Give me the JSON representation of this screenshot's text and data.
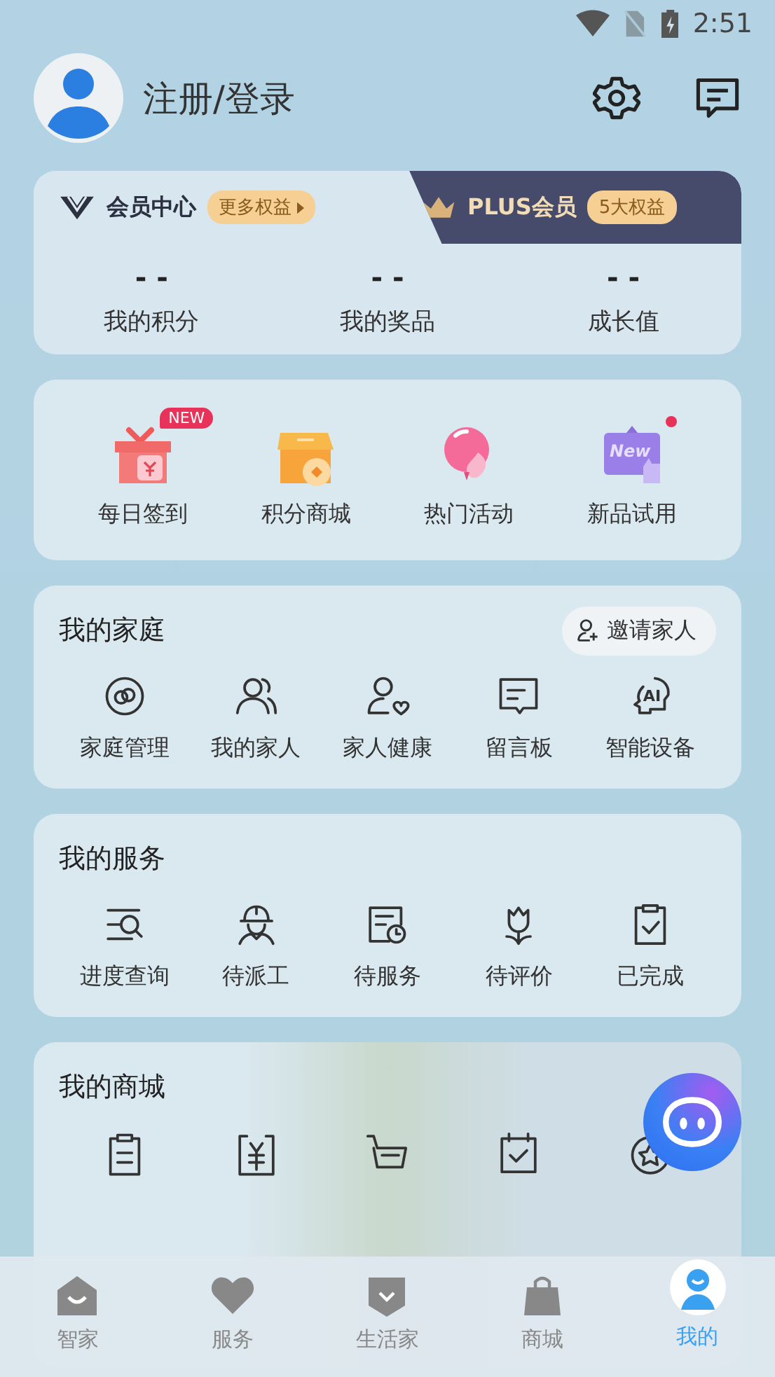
{
  "status_bar": {
    "time": "2:51"
  },
  "header": {
    "title": "注册/登录"
  },
  "member": {
    "tabs": [
      {
        "label": "会员中心",
        "badge": "更多权益",
        "kind": "member",
        "selected": true
      },
      {
        "label": "PLUS会员",
        "badge": "5大权益",
        "kind": "plus",
        "selected": false
      }
    ],
    "stats": [
      {
        "value": "- -",
        "label": "我的积分"
      },
      {
        "value": "- -",
        "label": "我的奖品"
      },
      {
        "value": "- -",
        "label": "成长值"
      }
    ]
  },
  "quick": [
    {
      "label": "每日签到",
      "kind": "gift",
      "badge": "NEW",
      "dot": false
    },
    {
      "label": "积分商城",
      "kind": "shop",
      "dot": false
    },
    {
      "label": "热门活动",
      "kind": "balloon",
      "dot": false
    },
    {
      "label": "新品试用",
      "kind": "new",
      "icon_text": "New",
      "dot": true
    }
  ],
  "family": {
    "title": "我的家庭",
    "action": "邀请家人",
    "items": [
      {
        "label": "家庭管理",
        "kind": "rings"
      },
      {
        "label": "我的家人",
        "kind": "people"
      },
      {
        "label": "家人健康",
        "kind": "health"
      },
      {
        "label": "留言板",
        "kind": "board"
      },
      {
        "label": "智能设备",
        "kind": "ai",
        "icon_text": "AI"
      }
    ]
  },
  "services": {
    "title": "我的服务",
    "items": [
      {
        "label": "进度查询",
        "kind": "search"
      },
      {
        "label": "待派工",
        "kind": "worker"
      },
      {
        "label": "待服务",
        "kind": "clock"
      },
      {
        "label": "待评价",
        "kind": "tulip"
      },
      {
        "label": "已完成",
        "kind": "done"
      }
    ]
  },
  "mall": {
    "title": "我的商城",
    "items": [
      {
        "kind": "order"
      },
      {
        "kind": "yen"
      },
      {
        "kind": "cart"
      },
      {
        "kind": "calendar"
      },
      {
        "kind": "star"
      }
    ]
  },
  "nav": [
    {
      "label": "智家",
      "kind": "home",
      "selected": false
    },
    {
      "label": "服务",
      "kind": "heart",
      "selected": false
    },
    {
      "label": "生活家",
      "kind": "shield",
      "selected": false
    },
    {
      "label": "商城",
      "kind": "bag",
      "selected": false
    },
    {
      "label": "我的",
      "kind": "me",
      "selected": true
    }
  ]
}
